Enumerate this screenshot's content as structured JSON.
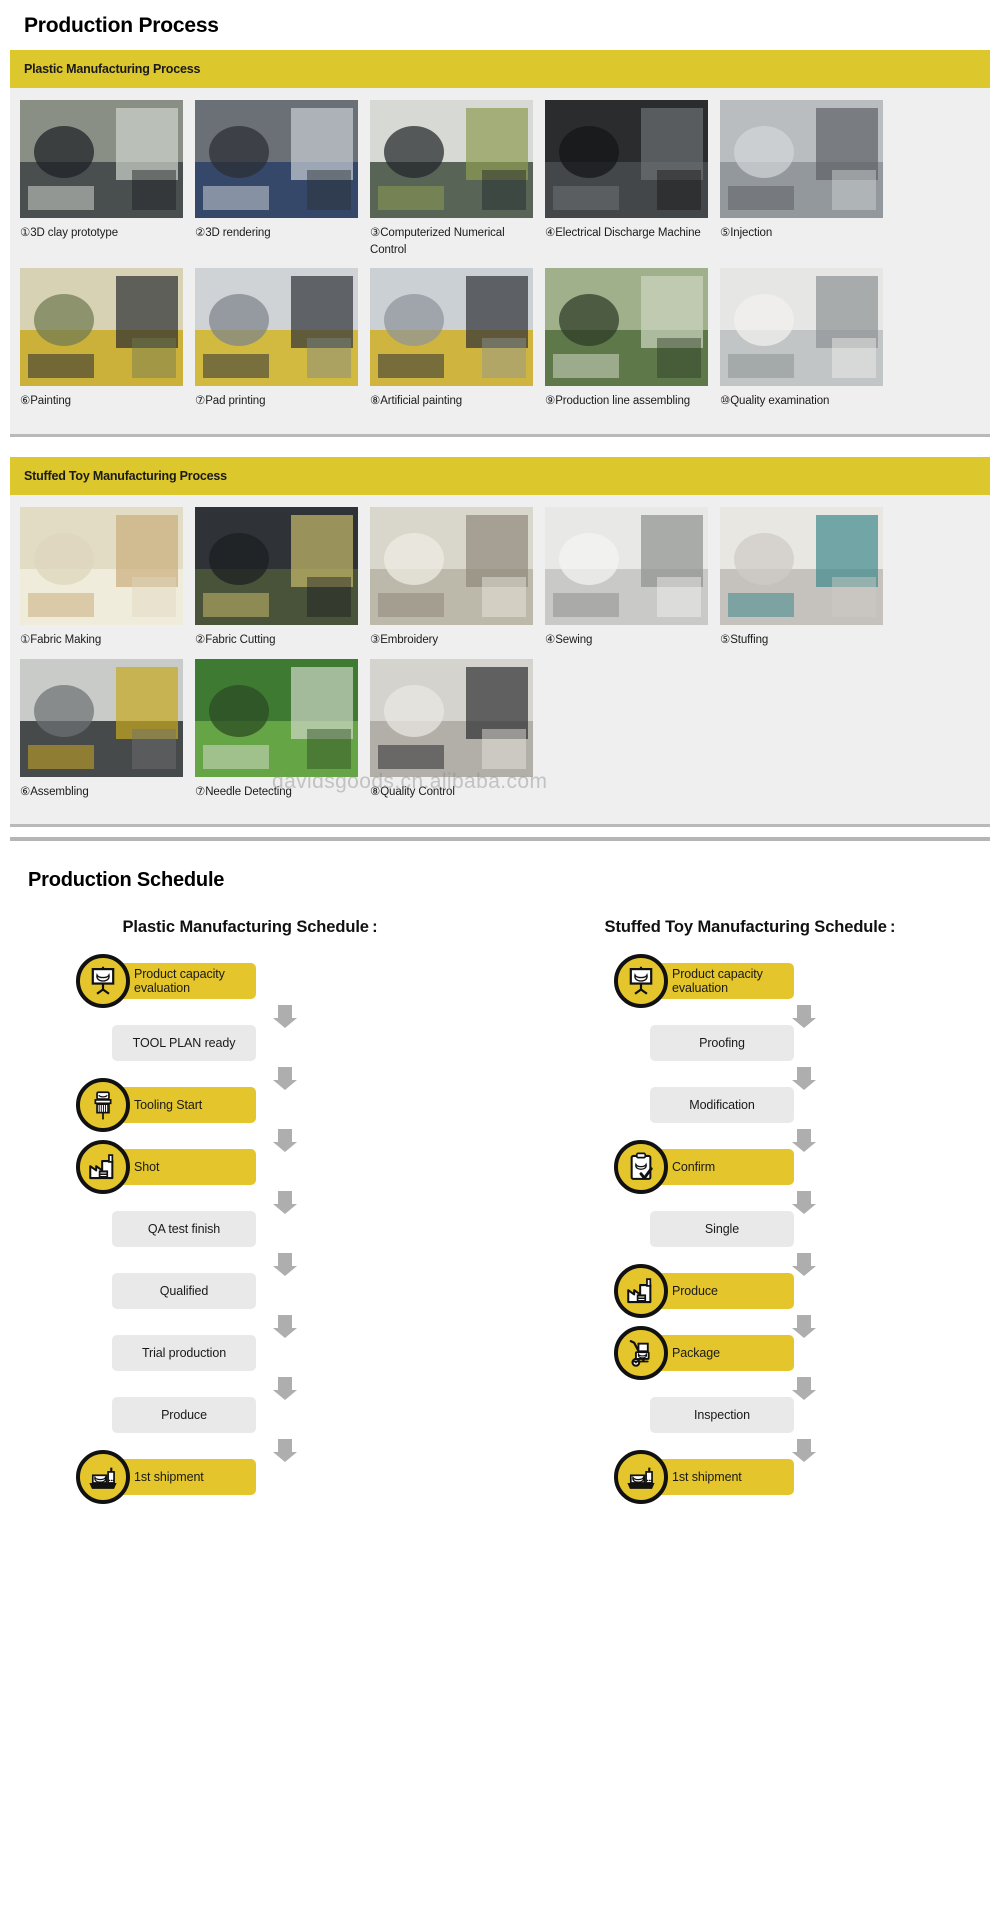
{
  "sections": {
    "process_title": "Production Process",
    "schedule_title": "Production Schedule"
  },
  "watermark": "davidsgoods.cn.alibaba.com",
  "panels": [
    {
      "header": "Plastic Manufacturing Process",
      "rows": [
        [
          {
            "caption": "①3D clay prototype",
            "image": "worker-clay-prototype-photo"
          },
          {
            "caption": "②3D rendering",
            "image": "worker-cad-monitor-photo"
          },
          {
            "caption": "③Computerized Numerical Control",
            "image": "cnc-machine-operator-photo"
          },
          {
            "caption": "④Electrical Discharge Machine",
            "image": "edm-machine-photo"
          },
          {
            "caption": "⑤Injection",
            "image": "injection-molding-hoppers-photo"
          }
        ],
        [
          {
            "caption": "⑥Painting",
            "image": "painting-line-workers-photo"
          },
          {
            "caption": "⑦Pad printing",
            "image": "pad-printing-worker-photo"
          },
          {
            "caption": "⑧Artificial painting",
            "image": "hand-painting-worker-photo"
          },
          {
            "caption": "⑨Production line assembling",
            "image": "assembly-line-photo"
          },
          {
            "caption": "⑩Quality examination",
            "image": "micrometer-measuring-photo"
          }
        ]
      ]
    },
    {
      "header": "Stuffed Toy Manufacturing Process",
      "rows": [
        [
          {
            "caption": "①Fabric Making",
            "image": "fabric-marking-photo"
          },
          {
            "caption": "②Fabric Cutting",
            "image": "fabric-cutting-photo"
          },
          {
            "caption": "③Embroidery",
            "image": "embroidery-machines-photo"
          },
          {
            "caption": "④Sewing",
            "image": "sewing-machine-photo"
          },
          {
            "caption": "⑤Stuffing",
            "image": "stuffing-fiber-photo"
          }
        ],
        [
          {
            "caption": "⑥Assembling",
            "image": "assembling-parts-photo"
          },
          {
            "caption": "⑦Needle Detecting",
            "image": "needle-detector-photo"
          },
          {
            "caption": "⑧Quality Control",
            "image": "quality-control-table-photo"
          },
          {
            "caption": "",
            "image": ""
          },
          {
            "caption": "",
            "image": ""
          }
        ]
      ]
    }
  ],
  "schedules": [
    {
      "heading": "Plastic Manufacturing Schedule :",
      "steps": [
        {
          "label": "Product capacity evaluation",
          "icon": "presentation-board-icon",
          "highlight": true
        },
        {
          "label": "TOOL PLAN ready",
          "icon": null,
          "highlight": false
        },
        {
          "label": "Tooling Start",
          "icon": "drill-bit-icon",
          "highlight": true
        },
        {
          "label": "Shot",
          "icon": "factory-icon",
          "highlight": true
        },
        {
          "label": "QA test finish",
          "icon": null,
          "highlight": false
        },
        {
          "label": "Qualified",
          "icon": null,
          "highlight": false
        },
        {
          "label": "Trial production",
          "icon": null,
          "highlight": false
        },
        {
          "label": "Produce",
          "icon": null,
          "highlight": false
        },
        {
          "label": "1st shipment",
          "icon": "cargo-ship-icon",
          "highlight": true
        }
      ]
    },
    {
      "heading": "Stuffed Toy Manufacturing Schedule :",
      "steps": [
        {
          "label": "Product capacity evaluation",
          "icon": "presentation-board-icon",
          "highlight": true
        },
        {
          "label": "Proofing",
          "icon": null,
          "highlight": false
        },
        {
          "label": "Modification",
          "icon": null,
          "highlight": false
        },
        {
          "label": "Confirm",
          "icon": "clipboard-check-icon",
          "highlight": true
        },
        {
          "label": "Single",
          "icon": null,
          "highlight": false
        },
        {
          "label": "Produce",
          "icon": "factory-icon",
          "highlight": true
        },
        {
          "label": "Package",
          "icon": "hand-truck-icon",
          "highlight": true
        },
        {
          "label": "Inspection",
          "icon": null,
          "highlight": false
        },
        {
          "label": "1st shipment",
          "icon": "cargo-ship-icon",
          "highlight": true
        }
      ]
    }
  ],
  "colors": {
    "accent_yellow": "#dcc72c",
    "step_yellow": "#e4c62c",
    "panel_gray": "#efefef",
    "step_gray": "#e9e9e9",
    "arrow_gray": "#aeaeae"
  }
}
